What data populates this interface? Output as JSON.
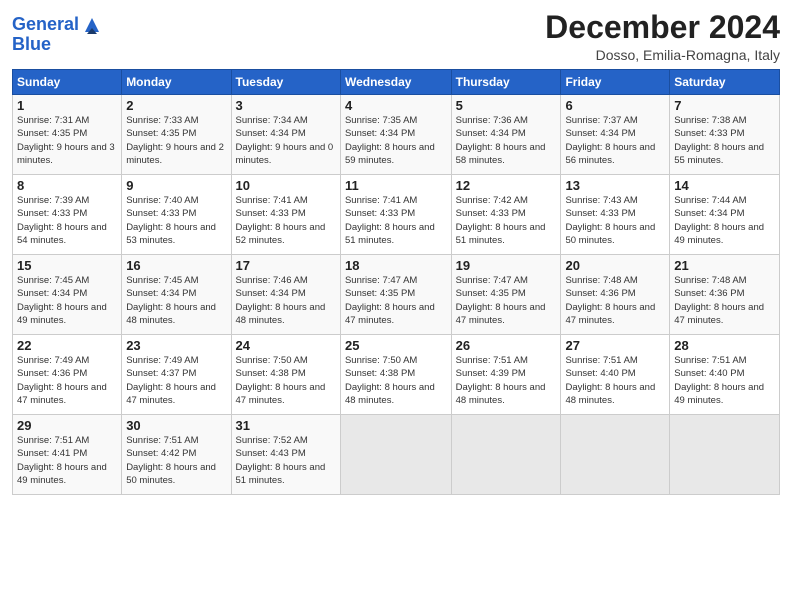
{
  "header": {
    "logo_line1": "General",
    "logo_line2": "Blue",
    "month": "December 2024",
    "location": "Dosso, Emilia-Romagna, Italy"
  },
  "weekdays": [
    "Sunday",
    "Monday",
    "Tuesday",
    "Wednesday",
    "Thursday",
    "Friday",
    "Saturday"
  ],
  "weeks": [
    [
      {
        "day": "1",
        "sunrise": "7:31 AM",
        "sunset": "4:35 PM",
        "daylight": "9 hours and 3 minutes."
      },
      {
        "day": "2",
        "sunrise": "7:33 AM",
        "sunset": "4:35 PM",
        "daylight": "9 hours and 2 minutes."
      },
      {
        "day": "3",
        "sunrise": "7:34 AM",
        "sunset": "4:34 PM",
        "daylight": "9 hours and 0 minutes."
      },
      {
        "day": "4",
        "sunrise": "7:35 AM",
        "sunset": "4:34 PM",
        "daylight": "8 hours and 59 minutes."
      },
      {
        "day": "5",
        "sunrise": "7:36 AM",
        "sunset": "4:34 PM",
        "daylight": "8 hours and 58 minutes."
      },
      {
        "day": "6",
        "sunrise": "7:37 AM",
        "sunset": "4:34 PM",
        "daylight": "8 hours and 56 minutes."
      },
      {
        "day": "7",
        "sunrise": "7:38 AM",
        "sunset": "4:33 PM",
        "daylight": "8 hours and 55 minutes."
      }
    ],
    [
      {
        "day": "8",
        "sunrise": "7:39 AM",
        "sunset": "4:33 PM",
        "daylight": "8 hours and 54 minutes."
      },
      {
        "day": "9",
        "sunrise": "7:40 AM",
        "sunset": "4:33 PM",
        "daylight": "8 hours and 53 minutes."
      },
      {
        "day": "10",
        "sunrise": "7:41 AM",
        "sunset": "4:33 PM",
        "daylight": "8 hours and 52 minutes."
      },
      {
        "day": "11",
        "sunrise": "7:41 AM",
        "sunset": "4:33 PM",
        "daylight": "8 hours and 51 minutes."
      },
      {
        "day": "12",
        "sunrise": "7:42 AM",
        "sunset": "4:33 PM",
        "daylight": "8 hours and 51 minutes."
      },
      {
        "day": "13",
        "sunrise": "7:43 AM",
        "sunset": "4:33 PM",
        "daylight": "8 hours and 50 minutes."
      },
      {
        "day": "14",
        "sunrise": "7:44 AM",
        "sunset": "4:34 PM",
        "daylight": "8 hours and 49 minutes."
      }
    ],
    [
      {
        "day": "15",
        "sunrise": "7:45 AM",
        "sunset": "4:34 PM",
        "daylight": "8 hours and 49 minutes."
      },
      {
        "day": "16",
        "sunrise": "7:45 AM",
        "sunset": "4:34 PM",
        "daylight": "8 hours and 48 minutes."
      },
      {
        "day": "17",
        "sunrise": "7:46 AM",
        "sunset": "4:34 PM",
        "daylight": "8 hours and 48 minutes."
      },
      {
        "day": "18",
        "sunrise": "7:47 AM",
        "sunset": "4:35 PM",
        "daylight": "8 hours and 47 minutes."
      },
      {
        "day": "19",
        "sunrise": "7:47 AM",
        "sunset": "4:35 PM",
        "daylight": "8 hours and 47 minutes."
      },
      {
        "day": "20",
        "sunrise": "7:48 AM",
        "sunset": "4:36 PM",
        "daylight": "8 hours and 47 minutes."
      },
      {
        "day": "21",
        "sunrise": "7:48 AM",
        "sunset": "4:36 PM",
        "daylight": "8 hours and 47 minutes."
      }
    ],
    [
      {
        "day": "22",
        "sunrise": "7:49 AM",
        "sunset": "4:36 PM",
        "daylight": "8 hours and 47 minutes."
      },
      {
        "day": "23",
        "sunrise": "7:49 AM",
        "sunset": "4:37 PM",
        "daylight": "8 hours and 47 minutes."
      },
      {
        "day": "24",
        "sunrise": "7:50 AM",
        "sunset": "4:38 PM",
        "daylight": "8 hours and 47 minutes."
      },
      {
        "day": "25",
        "sunrise": "7:50 AM",
        "sunset": "4:38 PM",
        "daylight": "8 hours and 48 minutes."
      },
      {
        "day": "26",
        "sunrise": "7:51 AM",
        "sunset": "4:39 PM",
        "daylight": "8 hours and 48 minutes."
      },
      {
        "day": "27",
        "sunrise": "7:51 AM",
        "sunset": "4:40 PM",
        "daylight": "8 hours and 48 minutes."
      },
      {
        "day": "28",
        "sunrise": "7:51 AM",
        "sunset": "4:40 PM",
        "daylight": "8 hours and 49 minutes."
      }
    ],
    [
      {
        "day": "29",
        "sunrise": "7:51 AM",
        "sunset": "4:41 PM",
        "daylight": "8 hours and 49 minutes."
      },
      {
        "day": "30",
        "sunrise": "7:51 AM",
        "sunset": "4:42 PM",
        "daylight": "8 hours and 50 minutes."
      },
      {
        "day": "31",
        "sunrise": "7:52 AM",
        "sunset": "4:43 PM",
        "daylight": "8 hours and 51 minutes."
      },
      null,
      null,
      null,
      null
    ]
  ]
}
